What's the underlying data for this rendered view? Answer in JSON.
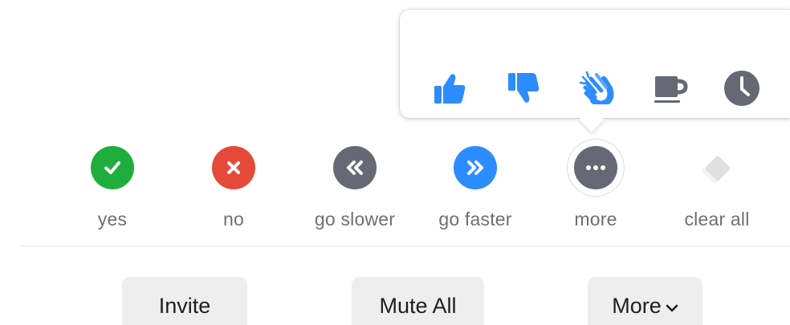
{
  "reactions": {
    "items": [
      {
        "name": "thumbs-up",
        "color": "#2d8cff"
      },
      {
        "name": "thumbs-down",
        "color": "#2d8cff"
      },
      {
        "name": "clap",
        "color": "#2d8cff"
      },
      {
        "name": "coffee",
        "color": "#666874"
      },
      {
        "name": "clock",
        "color": "#666874"
      }
    ]
  },
  "feedback": {
    "items": [
      {
        "label": "yes",
        "icon": "checkmark-icon",
        "color": "#1fae3b"
      },
      {
        "label": "no",
        "icon": "x-icon",
        "color": "#e5493a"
      },
      {
        "label": "go slower",
        "icon": "rewind-icon",
        "color": "#666874"
      },
      {
        "label": "go faster",
        "icon": "fast-forward-icon",
        "color": "#2d8cff"
      },
      {
        "label": "more",
        "icon": "ellipsis-icon",
        "color": "#666874"
      },
      {
        "label": "clear all",
        "icon": "clear-diamond-icon",
        "color": "#e3e3e3"
      }
    ]
  },
  "toolbar": {
    "invite_label": "Invite",
    "mute_all_label": "Mute All",
    "more_label": "More"
  }
}
